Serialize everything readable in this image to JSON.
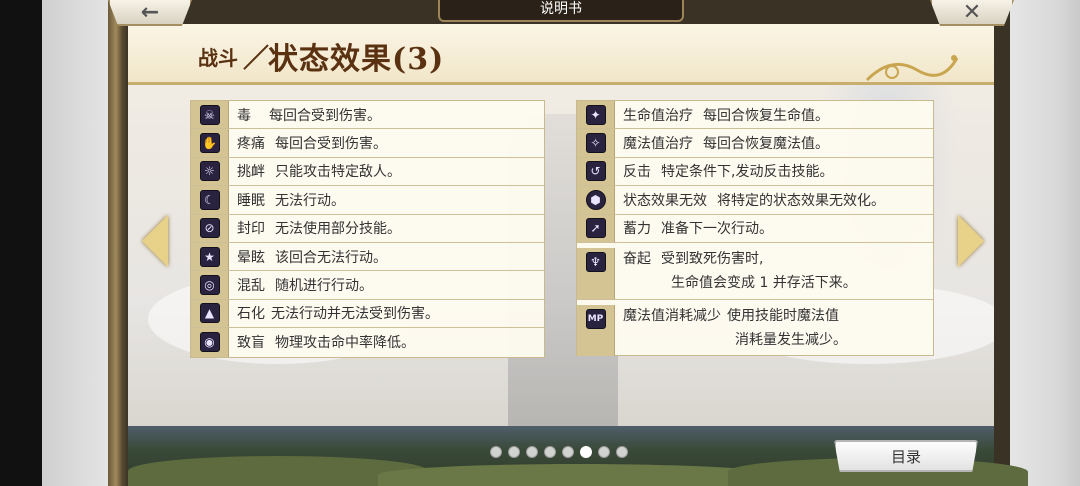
{
  "header": {
    "tab_title": "说明书",
    "back_symbol": "←",
    "close_symbol": "✕",
    "section": "战斗",
    "separator": "／",
    "title": "状态效果(3)"
  },
  "left_effects": [
    {
      "icon": "poison-icon",
      "glyph": "☠",
      "name": "毒",
      "desc": "每回合受到伤害。"
    },
    {
      "icon": "pain-icon",
      "glyph": "✋",
      "name": "疼痛",
      "desc": "每回合受到伤害。"
    },
    {
      "icon": "taunt-icon",
      "glyph": "☼",
      "name": "挑衅",
      "desc": "只能攻击特定敌人。"
    },
    {
      "icon": "sleep-icon",
      "glyph": "☾",
      "name": "睡眠",
      "desc": "无法行动。"
    },
    {
      "icon": "seal-icon",
      "glyph": "⊘",
      "name": "封印",
      "desc": "无法使用部分技能。"
    },
    {
      "icon": "stun-icon",
      "glyph": "★",
      "name": "晕眩",
      "desc": "该回合无法行动。"
    },
    {
      "icon": "confusion-icon",
      "glyph": "◎",
      "name": "混乱",
      "desc": "随机进行行动。"
    },
    {
      "icon": "petrify-icon",
      "glyph": "▲",
      "name": "石化",
      "desc": "无法行动并无法受到伤害。"
    },
    {
      "icon": "blind-icon",
      "glyph": "◉",
      "name": "致盲",
      "desc": "物理攻击命中率降低。"
    }
  ],
  "right_effects": [
    {
      "icon": "hp-regen-icon",
      "glyph": "✦",
      "name": "生命值治疗",
      "desc": "每回合恢复生命值。"
    },
    {
      "icon": "mp-regen-icon",
      "glyph": "✧",
      "name": "魔法值治疗",
      "desc": "每回合恢复魔法值。"
    },
    {
      "icon": "counter-icon",
      "glyph": "↺",
      "name": "反击",
      "desc": "特定条件下,发动反击技能。"
    },
    {
      "icon": "immunity-icon",
      "glyph": "⬢",
      "name": "状态效果无效",
      "desc": "将特定的状态效果无效化。"
    },
    {
      "icon": "charge-icon",
      "glyph": "➚",
      "name": "蓄力",
      "desc": "准备下一次行动。"
    },
    {
      "icon": "revive-icon",
      "glyph": "♆",
      "name": "奋起",
      "desc": "受到致死伤害时,",
      "desc2": "生命值会变成 1 并存活下来。"
    },
    {
      "icon": "mp-cost-down-icon",
      "glyph": "MP",
      "name": "魔法值消耗减少",
      "desc": "使用技能时魔法值",
      "desc2": "消耗量发生减少。"
    }
  ],
  "footer": {
    "toc_label": "目录",
    "page_count": 8,
    "current_page": 6
  }
}
